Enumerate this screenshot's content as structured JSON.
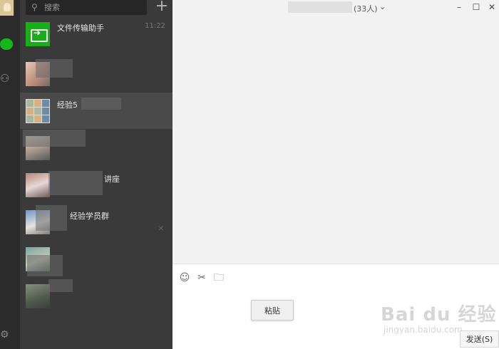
{
  "search": {
    "placeholder": "搜索"
  },
  "chats": [
    {
      "name": "文件传输助手",
      "time": "11:22"
    },
    {
      "name": "",
      "time": ""
    },
    {
      "name": "经验5",
      "time": ""
    },
    {
      "name": "",
      "time": ""
    },
    {
      "name": "讲座",
      "time": ""
    },
    {
      "name": "经验学员群",
      "time": ""
    },
    {
      "name": "",
      "time": ""
    },
    {
      "name": "",
      "time": ""
    }
  ],
  "chat_header": {
    "member_count": "(33人)"
  },
  "input": {
    "paste_label": "粘贴",
    "send_label": "发送(S)"
  },
  "watermark": {
    "brand": "Bai du 经验",
    "url": "jingyan.baidu.com"
  },
  "colors": {
    "accent": "#1aad19",
    "sidebar": "#2b2b2b",
    "list": "#3a3a3a"
  }
}
